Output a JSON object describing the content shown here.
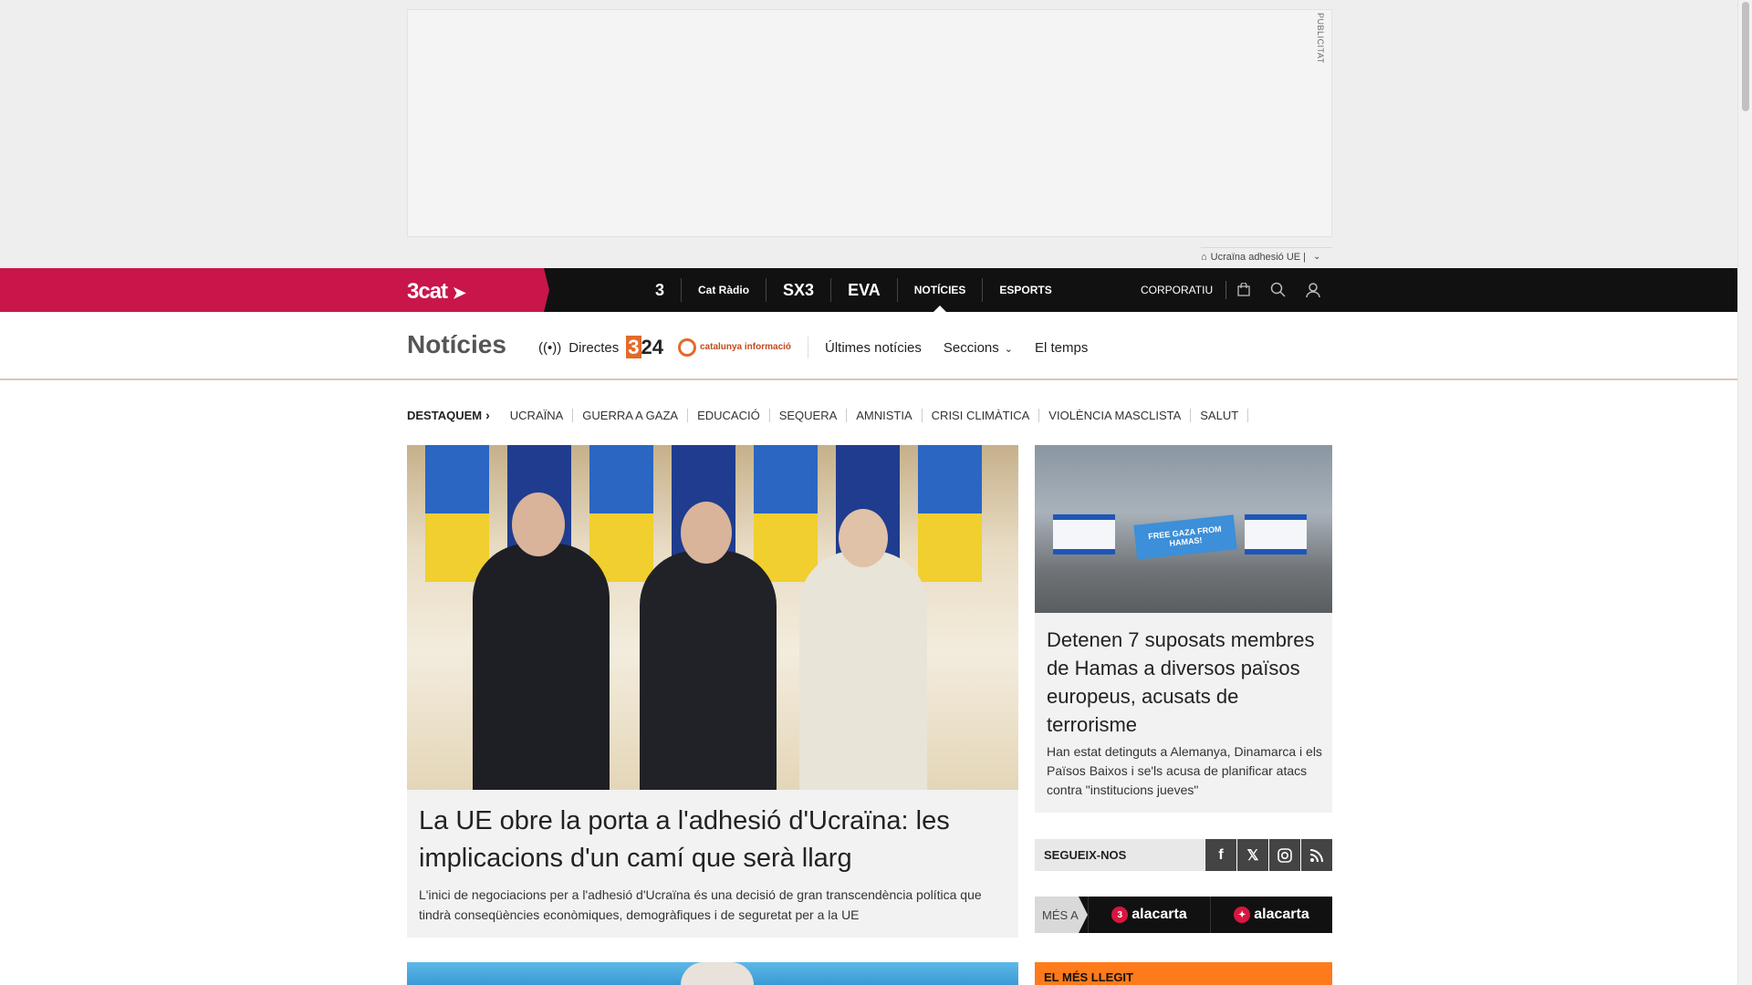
{
  "ad": {
    "label": "PUBLICITAT"
  },
  "tag": {
    "text": "Ucraïna adhesió UE |"
  },
  "topbar": {
    "brand": "3cat",
    "channels": [
      "3",
      "Cat Ràdio",
      "SX3",
      "EVA",
      "NOTÍCIES",
      "ESPORTS"
    ],
    "corporate": "CORPORATIU"
  },
  "section": {
    "title": "Notícies",
    "directes": "Directes",
    "logo324": "24",
    "logo324_box": "3",
    "logo_ci": "catalunya informació",
    "links": [
      "Últimes notícies",
      "Seccions",
      "El temps"
    ]
  },
  "destaquem": {
    "title": "DESTAQUEM",
    "items": [
      "UCRAÏNA",
      "GUERRA A GAZA",
      "EDUCACIÓ",
      "SEQUERA",
      "AMNISTIA",
      "CRISI CLIMÀTICA",
      "VIOLÈNCIA MASCLISTA",
      "SALUT"
    ]
  },
  "main_article": {
    "title": "La UE obre la porta a l'adhesió d'Ucraïna: les implicacions d'un camí que serà llarg",
    "subtitle": "L'inici de negociacions per a l'adhesió d'Ucraïna és una decisió de gran transcendència política que tindrà conseqüències econòmiques, demogràfiques i de seguretat per a la UE"
  },
  "side_article": {
    "banner": "FREE GAZA FROM HAMAS!",
    "title": "Detenen 7 suposats membres de Hamas a diversos països europeus, acusats de terrorisme",
    "subtitle": "Han estat detinguts a Alemanya, Dinamarca i els Països Baixos i se'ls acusa de planificar atacs contra \"institucions jueves\""
  },
  "follow": {
    "label": "SEGUEIX-NOS",
    "networks": [
      "facebook-icon",
      "x-icon",
      "instagram-icon",
      "rss-icon"
    ]
  },
  "mes_a": {
    "label": "MÉS A",
    "items": [
      {
        "badge": "3",
        "text": "alacarta"
      },
      {
        "badge": "✦",
        "text": "alacarta"
      }
    ]
  },
  "mes_llegit": {
    "title": "EL MÉS LLEGIT"
  },
  "colors": {
    "brand": "#c8164a",
    "topbar": "#111111",
    "accent": "#ff7a1a"
  }
}
